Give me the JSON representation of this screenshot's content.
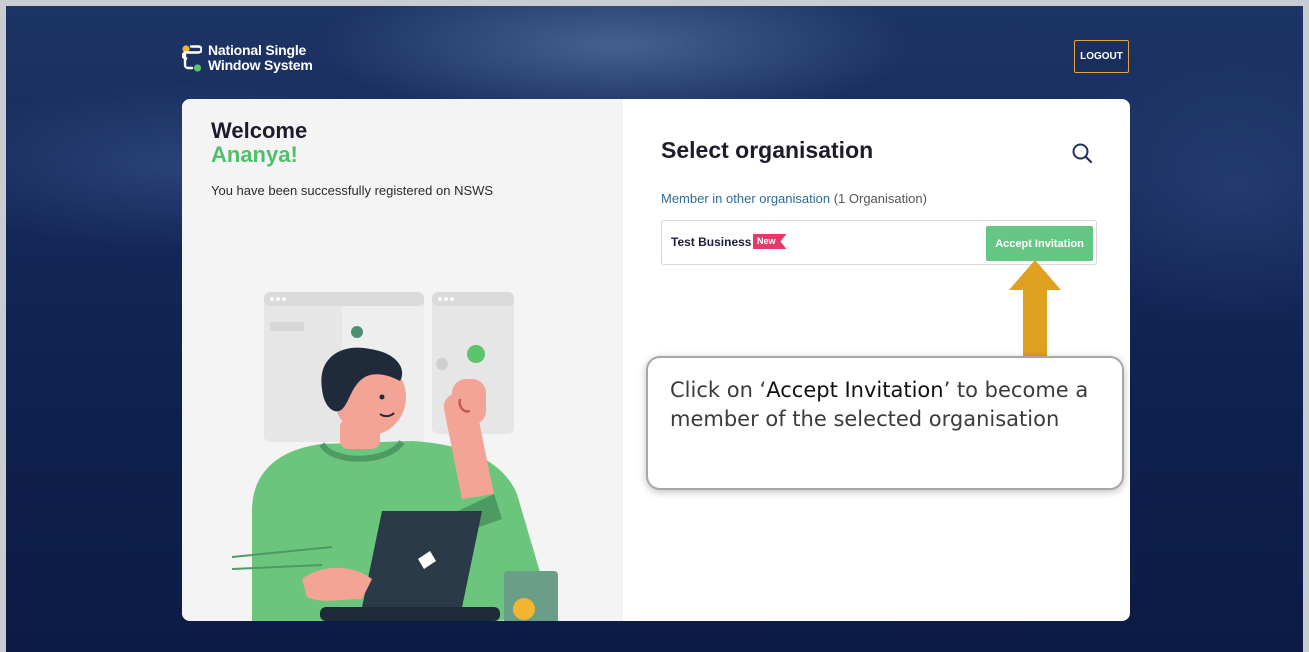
{
  "header": {
    "logo_line1": "National Single",
    "logo_line2": "Window System",
    "logout_label": "LOGOUT"
  },
  "welcome": {
    "title": "Welcome",
    "name": "Ananya!",
    "message": "You have been successfully registered on NSWS"
  },
  "organisation": {
    "title": "Select organisation",
    "member_label": "Member in other organisation",
    "member_count": "(1 Organisation)",
    "items": [
      {
        "name": "Test Business",
        "badge": "New",
        "action": "Accept Invitation"
      }
    ]
  },
  "callout": {
    "prefix": "Click on ‘",
    "highlight": "Accept Invitation",
    "suffix": "’ to become a member of the selected organisation"
  },
  "colors": {
    "accent_green": "#66c784",
    "name_green": "#4fbf6a",
    "badge_pink": "#e43a6a",
    "arrow_orange": "#e0a020",
    "background_navy": "#0f2150"
  }
}
